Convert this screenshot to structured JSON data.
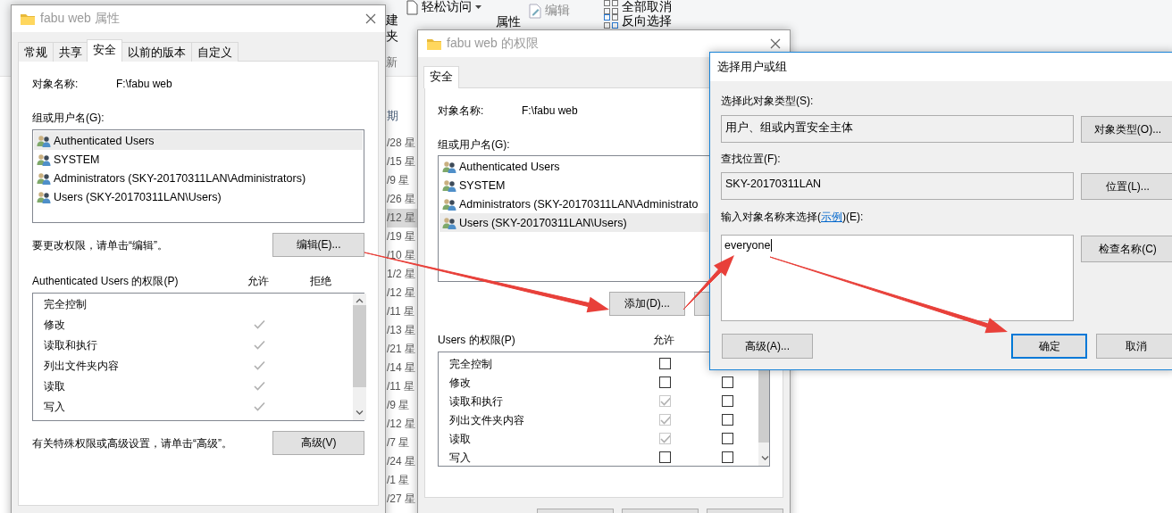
{
  "explorer": {
    "ribbon": {
      "new_fragment_top": "建",
      "new_fragment_bottom": "夹",
      "easy_access": "轻松访问",
      "properties": "属性",
      "edit": "编辑",
      "select_none": "全部取消",
      "invert_selection": "反向选择"
    },
    "group_label": "新",
    "column_header": "期",
    "dates": [
      {
        "text": "/28 星",
        "selected": false
      },
      {
        "text": "/15 星",
        "selected": false
      },
      {
        "text": "/9 星",
        "selected": false
      },
      {
        "text": "/26 星",
        "selected": false
      },
      {
        "text": "/12 星",
        "selected": true
      },
      {
        "text": "/19 星",
        "selected": false
      },
      {
        "text": "/10 星",
        "selected": false
      },
      {
        "text": "1/2 星",
        "selected": false
      },
      {
        "text": "/12 星",
        "selected": false
      },
      {
        "text": "/11 星",
        "selected": false
      },
      {
        "text": "/13 星",
        "selected": false
      },
      {
        "text": "/21 星",
        "selected": false
      },
      {
        "text": "/14 星",
        "selected": false
      },
      {
        "text": "/11 星",
        "selected": false
      },
      {
        "text": "/9 星",
        "selected": false
      },
      {
        "text": "/12 星",
        "selected": false
      },
      {
        "text": "/7 星",
        "selected": false
      },
      {
        "text": "/24 星",
        "selected": false
      },
      {
        "text": "/1 星",
        "selected": false
      },
      {
        "text": "/27 星",
        "selected": false
      }
    ]
  },
  "properties_dialog": {
    "title": "fabu web 属性",
    "tabs": [
      {
        "label": "常规",
        "selected": false
      },
      {
        "label": "共享",
        "selected": false
      },
      {
        "label": "安全",
        "selected": true
      },
      {
        "label": "以前的版本",
        "selected": false
      },
      {
        "label": "自定义",
        "selected": false
      }
    ],
    "object_label": "对象名称:",
    "object_value": "F:\\fabu web",
    "groups_label": "组或用户名(G):",
    "users": [
      {
        "name": "Authenticated Users",
        "selected": true
      },
      {
        "name": "SYSTEM",
        "selected": false
      },
      {
        "name": "Administrators (SKY-20170311LAN\\Administrators)",
        "selected": false
      },
      {
        "name": "Users (SKY-20170311LAN\\Users)",
        "selected": false
      }
    ],
    "edit_hint": "要更改权限，请单击“编辑”。",
    "edit_button": "编辑(E)...",
    "permissions_label": "Authenticated Users 的权限(P)",
    "allow_header": "允许",
    "deny_header": "拒绝",
    "permissions": [
      {
        "name": "完全控制",
        "allow": false,
        "deny": false
      },
      {
        "name": "修改",
        "allow": true,
        "deny": false
      },
      {
        "name": "读取和执行",
        "allow": true,
        "deny": false
      },
      {
        "name": "列出文件夹内容",
        "allow": true,
        "deny": false
      },
      {
        "name": "读取",
        "allow": true,
        "deny": false
      },
      {
        "name": "写入",
        "allow": true,
        "deny": false
      }
    ],
    "advanced_hint": "有关特殊权限或高级设置，请单击“高级”。",
    "advanced_button": "高级(V)"
  },
  "permissions_dialog": {
    "title": "fabu web 的权限",
    "tabs": [
      {
        "label": "安全",
        "selected": true
      }
    ],
    "object_label": "对象名称:",
    "object_value": "F:\\fabu web",
    "groups_label": "组或用户名(G):",
    "users": [
      {
        "name": "Authenticated Users",
        "selected": false
      },
      {
        "name": "SYSTEM",
        "selected": false
      },
      {
        "name": "Administrators (SKY-20170311LAN\\Administrato",
        "selected": false
      },
      {
        "name": "Users (SKY-20170311LAN\\Users)",
        "selected": true
      }
    ],
    "add_button": "添加(D)...",
    "permissions_label": "Users 的权限(P)",
    "allow_header": "允许",
    "permissions": [
      {
        "name": "完全控制",
        "allow": false,
        "allow_disabled": false
      },
      {
        "name": "修改",
        "allow": false,
        "allow_disabled": false,
        "deny": false
      },
      {
        "name": "读取和执行",
        "allow": true,
        "allow_disabled": true,
        "deny": false
      },
      {
        "name": "列出文件夹内容",
        "allow": true,
        "allow_disabled": true,
        "deny": false
      },
      {
        "name": "读取",
        "allow": true,
        "allow_disabled": true,
        "deny": false
      },
      {
        "name": "写入",
        "allow": false,
        "allow_disabled": false,
        "deny": false
      }
    ]
  },
  "select_dialog": {
    "title": "选择用户或组",
    "object_type_label": "选择此对象类型(S):",
    "object_type_value": "用户、组或内置安全主体",
    "object_type_button": "对象类型(O)...",
    "location_label": "查找位置(F):",
    "location_value": "SKY-20170311LAN",
    "location_button": "位置(L)...",
    "names_label_before": "输入对象名称来选择(",
    "examples_link": "示例",
    "names_label_after": ")(E):",
    "names_value": "everyone",
    "check_names_button": "检查名称(C)",
    "advanced_button": "高级(A)...",
    "ok_button": {
      "label": "确定",
      "focused": true
    },
    "cancel_button": "取消"
  }
}
